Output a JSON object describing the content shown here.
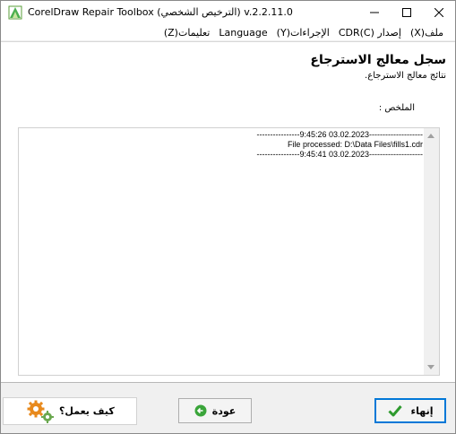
{
  "window": {
    "title": "CorelDraw Repair Toolbox (الترخيص الشخصي) v.2.2.11.0"
  },
  "menu": {
    "items": [
      "ملف(X)",
      "إصدار CDR(C)",
      "الإجراءات(Y)",
      "Language",
      "تعليمات(Z)"
    ]
  },
  "header": {
    "title": "سجل معالج الاسترجاع",
    "subtitle": "نتائج معالج الاسترجاع."
  },
  "content": {
    "summary_label": "الملخص :",
    "log_lines": [
      "----------------9:45:26 03.02.2023--------------------",
      "File processed: D:\\Data Files\\fills1.cdr",
      "----------------9:45:41 03.02.2023--------------------"
    ]
  },
  "footer": {
    "howto_label": "كيف يعمل؟",
    "back_label": "عودة",
    "finish_label": "إنهاء"
  },
  "icons": {
    "app": "app-icon",
    "minimize": "minimize-icon",
    "maximize": "maximize-icon",
    "close": "close-icon",
    "gears": "gears-icon",
    "back": "back-arrow-icon",
    "check": "checkmark-icon"
  },
  "colors": {
    "accent_green": "#3aa53a",
    "focus_blue": "#0078d7",
    "gear_orange": "#e8891c",
    "gear_green": "#6aa84f"
  }
}
